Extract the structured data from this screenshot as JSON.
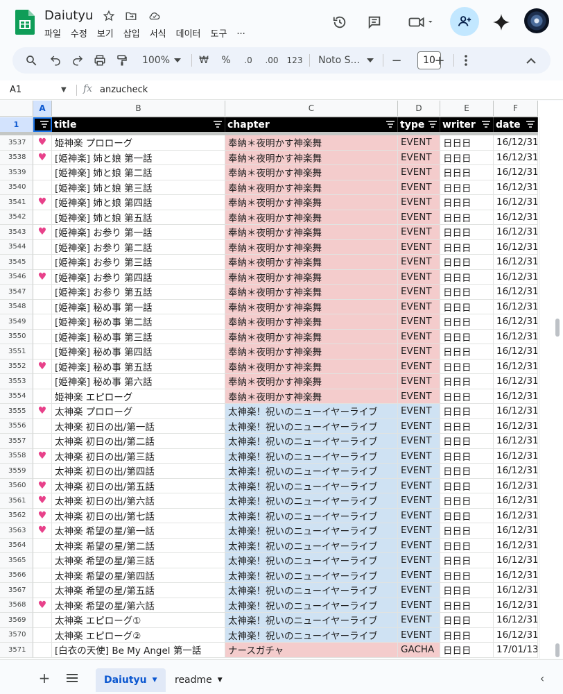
{
  "app": {
    "title": "Daiutyu",
    "menu": [
      "파일",
      "수정",
      "보기",
      "삽입",
      "서식",
      "데이터",
      "도구",
      "..."
    ]
  },
  "toolbar": {
    "zoom": "100%",
    "currency": "₩",
    "percent": "%",
    "dec_decrease": ".0",
    "dec_increase": ".00",
    "number_format": "123",
    "font": "Noto S...",
    "font_size": "10",
    "minus": "−",
    "plus": "+"
  },
  "formula_bar": {
    "cell_ref": "A1",
    "fx": "fx",
    "value": "anzucheck"
  },
  "columns": [
    {
      "letter": "A",
      "header": ""
    },
    {
      "letter": "B",
      "header": "title"
    },
    {
      "letter": "C",
      "header": "chapter"
    },
    {
      "letter": "D",
      "header": "type"
    },
    {
      "letter": "E",
      "header": "writer"
    },
    {
      "letter": "F",
      "header": "date"
    }
  ],
  "frozen_row_number": "1",
  "rows": [
    {
      "n": "3537",
      "heart": true,
      "title": "姫神楽 プロローグ",
      "chapter": "奉納＊夜明かす神楽舞",
      "color": "pink",
      "type": "EVENT",
      "writer": "日日日",
      "date": "16/12/31"
    },
    {
      "n": "3538",
      "heart": true,
      "title": "[姫神楽] 姉と娘 第一話",
      "chapter": "奉納＊夜明かす神楽舞",
      "color": "pink",
      "type": "EVENT",
      "writer": "日日日",
      "date": "16/12/31"
    },
    {
      "n": "3539",
      "heart": false,
      "title": "[姫神楽] 姉と娘 第二話",
      "chapter": "奉納＊夜明かす神楽舞",
      "color": "pink",
      "type": "EVENT",
      "writer": "日日日",
      "date": "16/12/31"
    },
    {
      "n": "3540",
      "heart": false,
      "title": "[姫神楽] 姉と娘 第三話",
      "chapter": "奉納＊夜明かす神楽舞",
      "color": "pink",
      "type": "EVENT",
      "writer": "日日日",
      "date": "16/12/31"
    },
    {
      "n": "3541",
      "heart": true,
      "title": "[姫神楽] 姉と娘 第四話",
      "chapter": "奉納＊夜明かす神楽舞",
      "color": "pink",
      "type": "EVENT",
      "writer": "日日日",
      "date": "16/12/31"
    },
    {
      "n": "3542",
      "heart": false,
      "title": "[姫神楽] 姉と娘 第五話",
      "chapter": "奉納＊夜明かす神楽舞",
      "color": "pink",
      "type": "EVENT",
      "writer": "日日日",
      "date": "16/12/31"
    },
    {
      "n": "3543",
      "heart": true,
      "title": "[姫神楽] お参り 第一話",
      "chapter": "奉納＊夜明かす神楽舞",
      "color": "pink",
      "type": "EVENT",
      "writer": "日日日",
      "date": "16/12/31"
    },
    {
      "n": "3544",
      "heart": false,
      "title": "[姫神楽] お参り 第二話",
      "chapter": "奉納＊夜明かす神楽舞",
      "color": "pink",
      "type": "EVENT",
      "writer": "日日日",
      "date": "16/12/31"
    },
    {
      "n": "3545",
      "heart": false,
      "title": "[姫神楽] お参り 第三話",
      "chapter": "奉納＊夜明かす神楽舞",
      "color": "pink",
      "type": "EVENT",
      "writer": "日日日",
      "date": "16/12/31"
    },
    {
      "n": "3546",
      "heart": true,
      "title": "[姫神楽] お参り 第四話",
      "chapter": "奉納＊夜明かす神楽舞",
      "color": "pink",
      "type": "EVENT",
      "writer": "日日日",
      "date": "16/12/31"
    },
    {
      "n": "3547",
      "heart": false,
      "title": "[姫神楽] お参り 第五話",
      "chapter": "奉納＊夜明かす神楽舞",
      "color": "pink",
      "type": "EVENT",
      "writer": "日日日",
      "date": "16/12/31"
    },
    {
      "n": "3548",
      "heart": false,
      "title": "[姫神楽] 秘め事 第一話",
      "chapter": "奉納＊夜明かす神楽舞",
      "color": "pink",
      "type": "EVENT",
      "writer": "日日日",
      "date": "16/12/31"
    },
    {
      "n": "3549",
      "heart": false,
      "title": "[姫神楽] 秘め事 第二話",
      "chapter": "奉納＊夜明かす神楽舞",
      "color": "pink",
      "type": "EVENT",
      "writer": "日日日",
      "date": "16/12/31"
    },
    {
      "n": "3550",
      "heart": false,
      "title": "[姫神楽] 秘め事 第三話",
      "chapter": "奉納＊夜明かす神楽舞",
      "color": "pink",
      "type": "EVENT",
      "writer": "日日日",
      "date": "16/12/31"
    },
    {
      "n": "3551",
      "heart": false,
      "title": "[姫神楽] 秘め事 第四話",
      "chapter": "奉納＊夜明かす神楽舞",
      "color": "pink",
      "type": "EVENT",
      "writer": "日日日",
      "date": "16/12/31"
    },
    {
      "n": "3552",
      "heart": true,
      "title": "[姫神楽] 秘め事 第五話",
      "chapter": "奉納＊夜明かす神楽舞",
      "color": "pink",
      "type": "EVENT",
      "writer": "日日日",
      "date": "16/12/31"
    },
    {
      "n": "3553",
      "heart": false,
      "title": "[姫神楽] 秘め事 第六話",
      "chapter": "奉納＊夜明かす神楽舞",
      "color": "pink",
      "type": "EVENT",
      "writer": "日日日",
      "date": "16/12/31"
    },
    {
      "n": "3554",
      "heart": false,
      "title": "姫神楽 エピローグ",
      "chapter": "奉納＊夜明かす神楽舞",
      "color": "pink",
      "type": "EVENT",
      "writer": "日日日",
      "date": "16/12/31"
    },
    {
      "n": "3555",
      "heart": true,
      "title": "太神楽 プロローグ",
      "chapter": "太神楽！祝いのニューイヤーライブ",
      "color": "blue",
      "type": "EVENT",
      "writer": "日日日",
      "date": "16/12/31"
    },
    {
      "n": "3556",
      "heart": false,
      "title": "太神楽 初日の出/第一話",
      "chapter": "太神楽！祝いのニューイヤーライブ",
      "color": "blue",
      "type": "EVENT",
      "writer": "日日日",
      "date": "16/12/31"
    },
    {
      "n": "3557",
      "heart": false,
      "title": "太神楽 初日の出/第二話",
      "chapter": "太神楽！祝いのニューイヤーライブ",
      "color": "blue",
      "type": "EVENT",
      "writer": "日日日",
      "date": "16/12/31"
    },
    {
      "n": "3558",
      "heart": true,
      "title": "太神楽 初日の出/第三話",
      "chapter": "太神楽！祝いのニューイヤーライブ",
      "color": "blue",
      "type": "EVENT",
      "writer": "日日日",
      "date": "16/12/31"
    },
    {
      "n": "3559",
      "heart": false,
      "title": "太神楽 初日の出/第四話",
      "chapter": "太神楽！祝いのニューイヤーライブ",
      "color": "blue",
      "type": "EVENT",
      "writer": "日日日",
      "date": "16/12/31"
    },
    {
      "n": "3560",
      "heart": true,
      "title": "太神楽 初日の出/第五話",
      "chapter": "太神楽！祝いのニューイヤーライブ",
      "color": "blue",
      "type": "EVENT",
      "writer": "日日日",
      "date": "16/12/31"
    },
    {
      "n": "3561",
      "heart": true,
      "title": "太神楽 初日の出/第六話",
      "chapter": "太神楽！祝いのニューイヤーライブ",
      "color": "blue",
      "type": "EVENT",
      "writer": "日日日",
      "date": "16/12/31"
    },
    {
      "n": "3562",
      "heart": true,
      "title": "太神楽 初日の出/第七話",
      "chapter": "太神楽！祝いのニューイヤーライブ",
      "color": "blue",
      "type": "EVENT",
      "writer": "日日日",
      "date": "16/12/31"
    },
    {
      "n": "3563",
      "heart": true,
      "title": "太神楽 希望の星/第一話",
      "chapter": "太神楽！祝いのニューイヤーライブ",
      "color": "blue",
      "type": "EVENT",
      "writer": "日日日",
      "date": "16/12/31"
    },
    {
      "n": "3564",
      "heart": false,
      "title": "太神楽 希望の星/第二話",
      "chapter": "太神楽！祝いのニューイヤーライブ",
      "color": "blue",
      "type": "EVENT",
      "writer": "日日日",
      "date": "16/12/31"
    },
    {
      "n": "3565",
      "heart": false,
      "title": "太神楽 希望の星/第三話",
      "chapter": "太神楽！祝いのニューイヤーライブ",
      "color": "blue",
      "type": "EVENT",
      "writer": "日日日",
      "date": "16/12/31"
    },
    {
      "n": "3566",
      "heart": false,
      "title": "太神楽 希望の星/第四話",
      "chapter": "太神楽！祝いのニューイヤーライブ",
      "color": "blue",
      "type": "EVENT",
      "writer": "日日日",
      "date": "16/12/31"
    },
    {
      "n": "3567",
      "heart": false,
      "title": "太神楽 希望の星/第五話",
      "chapter": "太神楽！祝いのニューイヤーライブ",
      "color": "blue",
      "type": "EVENT",
      "writer": "日日日",
      "date": "16/12/31"
    },
    {
      "n": "3568",
      "heart": true,
      "title": "太神楽 希望の星/第六話",
      "chapter": "太神楽！祝いのニューイヤーライブ",
      "color": "blue",
      "type": "EVENT",
      "writer": "日日日",
      "date": "16/12/31"
    },
    {
      "n": "3569",
      "heart": false,
      "title": "太神楽 エピローグ①",
      "chapter": "太神楽！祝いのニューイヤーライブ",
      "color": "blue",
      "type": "EVENT",
      "writer": "日日日",
      "date": "16/12/31"
    },
    {
      "n": "3570",
      "heart": false,
      "title": "太神楽 エピローグ②",
      "chapter": "太神楽！祝いのニューイヤーライブ",
      "color": "blue",
      "type": "EVENT",
      "writer": "日日日",
      "date": "16/12/31"
    },
    {
      "n": "3571",
      "heart": false,
      "title": "[白衣の天使] Be My Angel 第一話",
      "chapter": "ナースガチャ",
      "color": "pink",
      "type": "GACHA",
      "writer": "日日日",
      "date": "17/01/13"
    }
  ],
  "sheets": [
    {
      "name": "Daiutyu",
      "active": true
    },
    {
      "name": "readme",
      "active": false
    }
  ],
  "colors": {
    "pink_fill": "#f4cccc",
    "blue_fill": "#cfe2f3",
    "heart": "#e8418a",
    "accent": "#0b57d0"
  }
}
